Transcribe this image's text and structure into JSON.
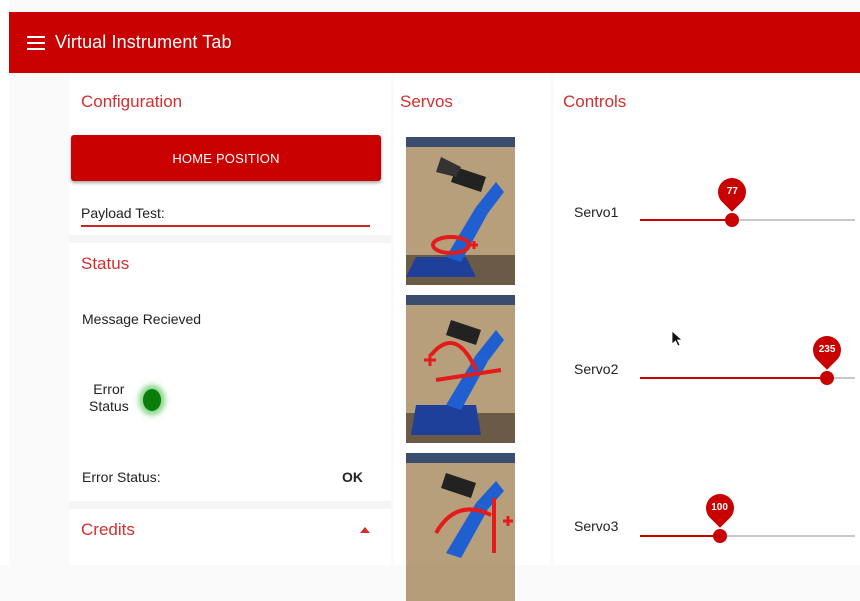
{
  "app": {
    "title": "Virtual Instrument Tab",
    "accent": "#c80000"
  },
  "configuration": {
    "title": "Configuration",
    "home_button": "HOME POSITION",
    "payload_label": "Payload Test:"
  },
  "status": {
    "title": "Status",
    "message": "Message Recieved",
    "error_label_line1": "Error",
    "error_label_line2": "Status",
    "led_color": "#0b7d0b",
    "error_status_label": "Error Status:",
    "error_status_value": "OK"
  },
  "credits": {
    "title": "Credits"
  },
  "servos": {
    "title": "Servos"
  },
  "controls": {
    "title": "Controls",
    "sliders": [
      {
        "label": "Servo1",
        "value": 77,
        "fraction": 0.43
      },
      {
        "label": "Servo2",
        "value": 235,
        "fraction": 0.87
      },
      {
        "label": "Servo3",
        "value": 100,
        "fraction": 0.37
      }
    ]
  }
}
